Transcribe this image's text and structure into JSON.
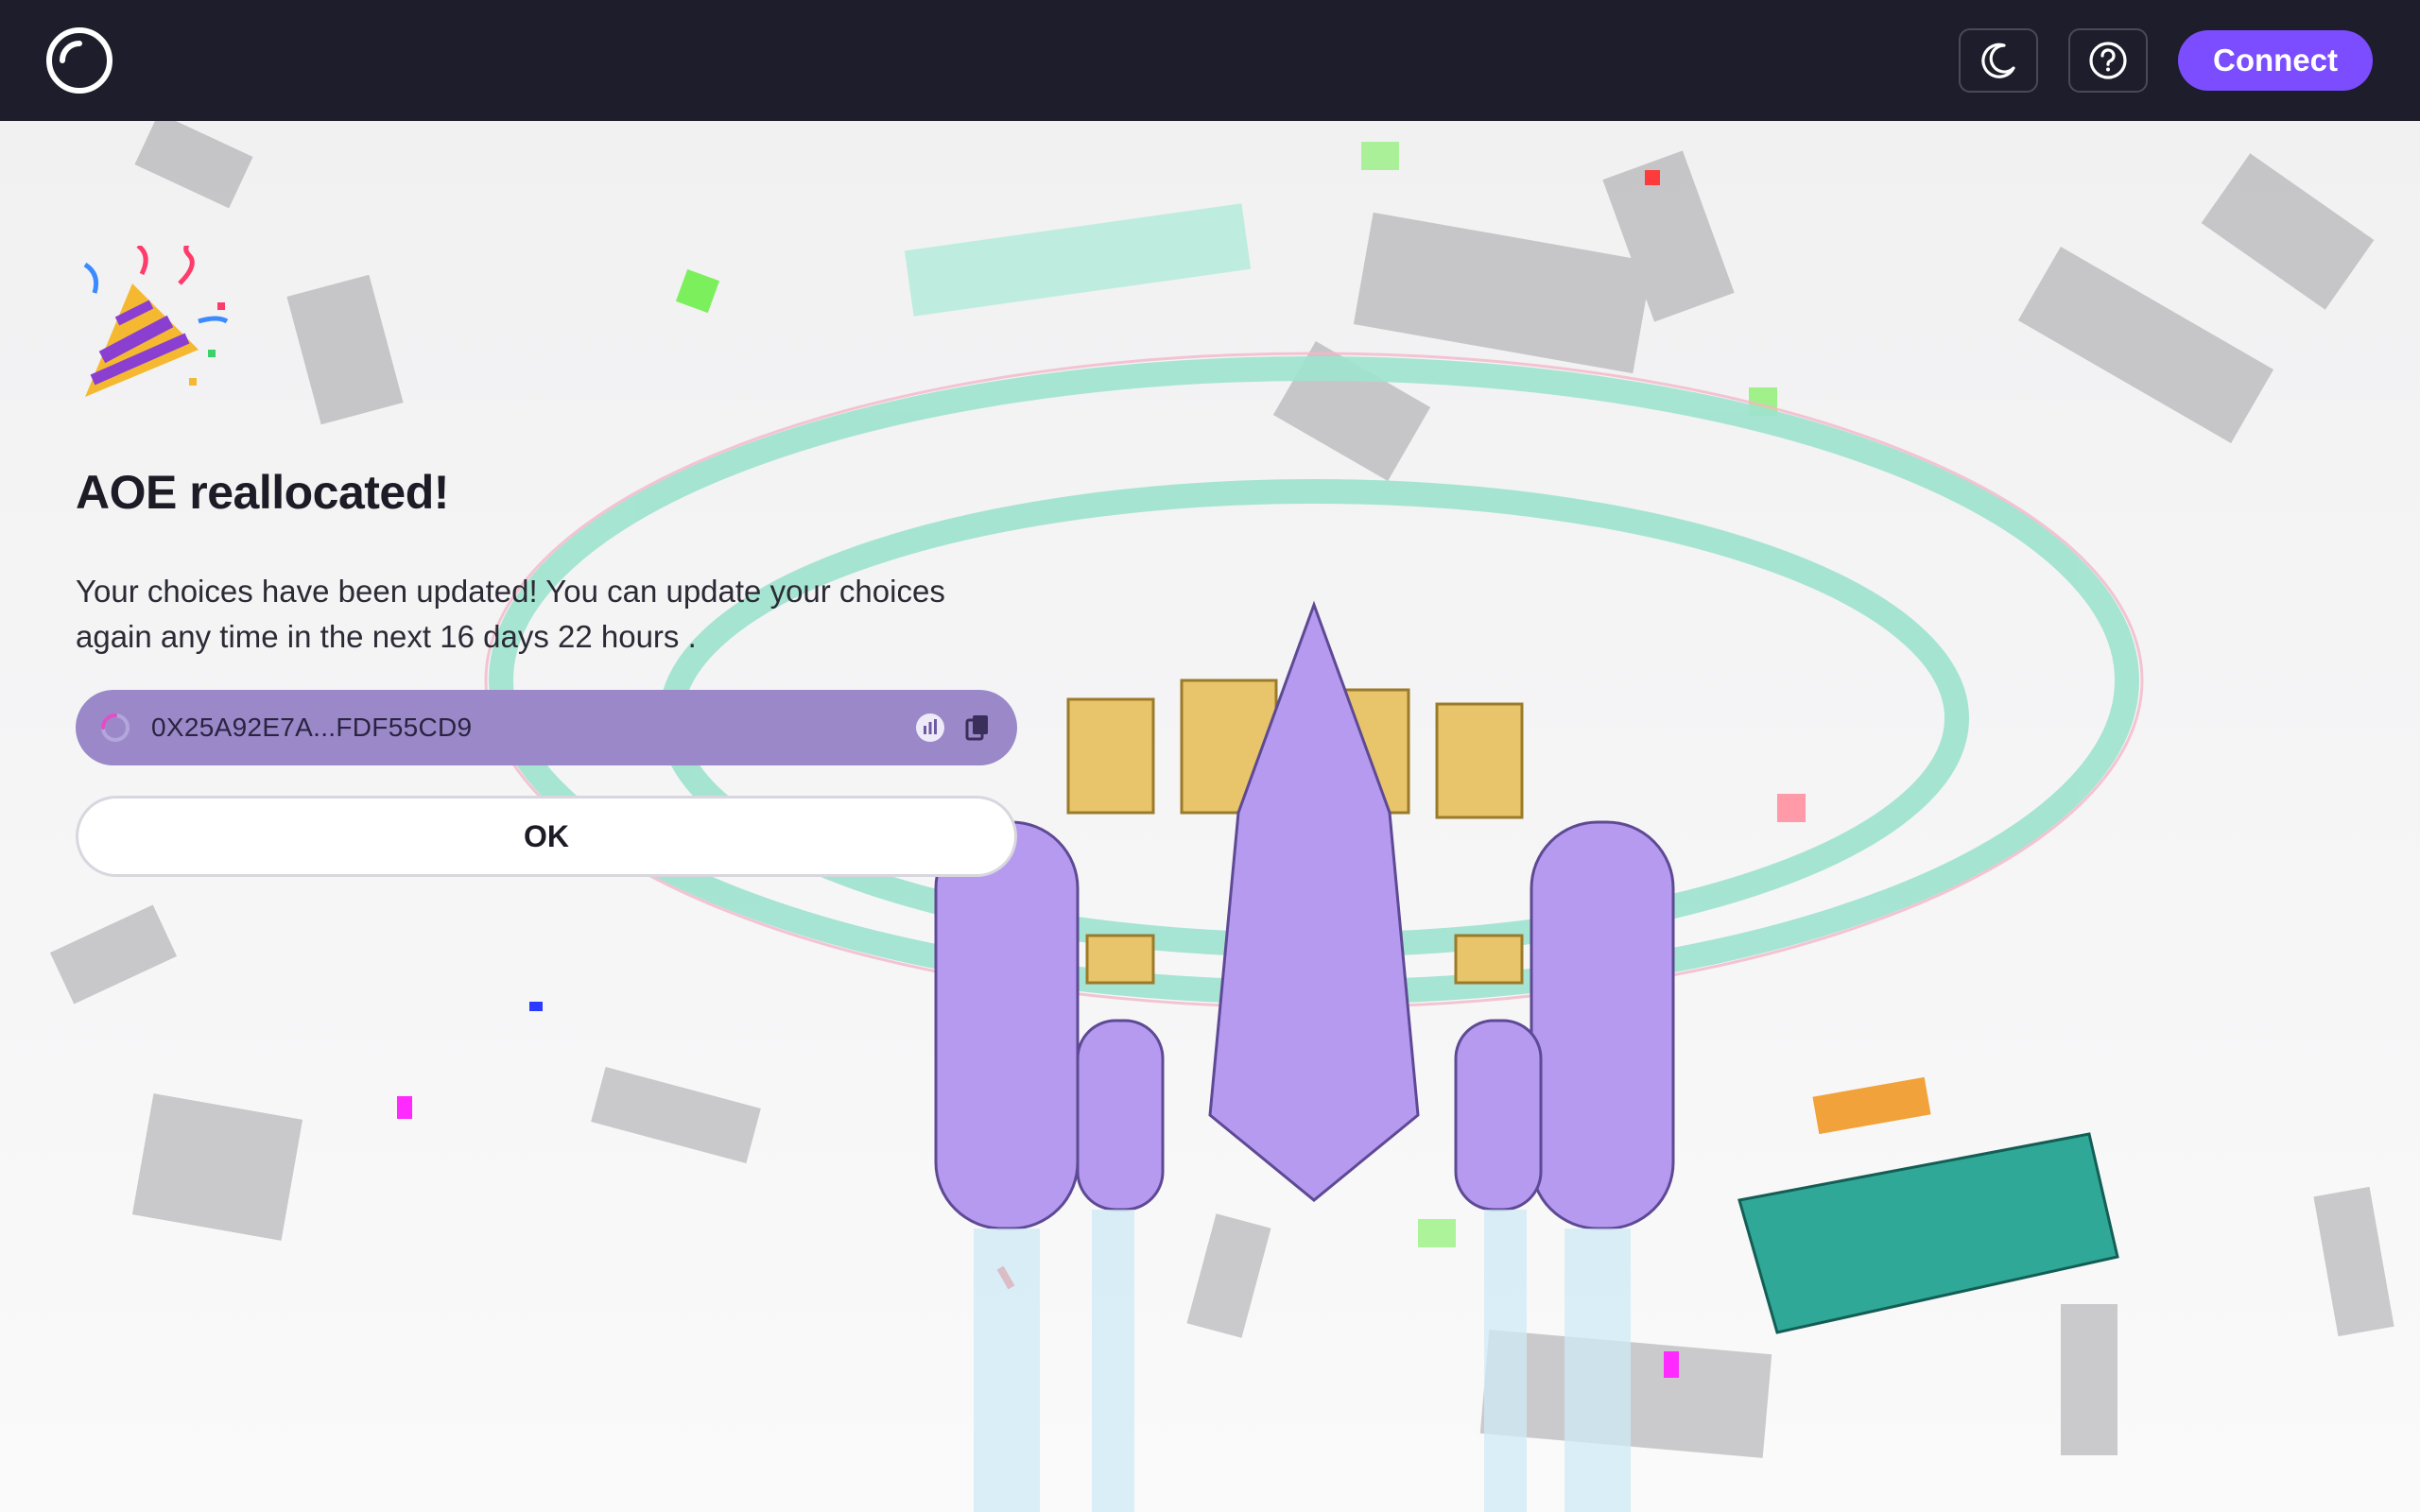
{
  "header": {
    "logo_icon": "ring-logo-icon",
    "theme_icon": "moon-icon",
    "help_icon": "question-circle-icon",
    "connect_label": "Connect"
  },
  "modal": {
    "emoji_icon": "party-popper-icon",
    "title": "AOE reallocated!",
    "description": "Your choices have been updated! You can update your choices again any time in the next 16 days 22 hours .",
    "address": "0X25A92E7A...FDF55CD9",
    "address_icons": [
      "loading-spinner-icon",
      "explorer-chart-icon",
      "copy-icon"
    ],
    "ok_label": "OK"
  },
  "colors": {
    "topbar": "#1e1d2b",
    "accent": "#7b4dff",
    "address_pill": "#9a88c9",
    "ring": "#a8e6d4",
    "ship": "#b69af0"
  }
}
